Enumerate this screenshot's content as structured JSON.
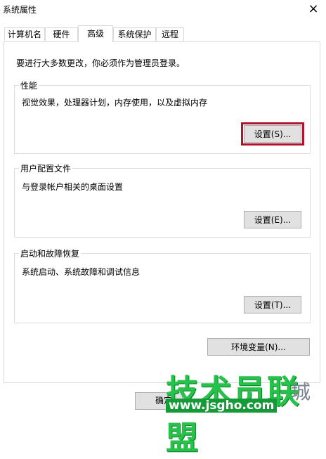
{
  "window": {
    "title": "系统属性",
    "close_glyph": "×"
  },
  "tabs": [
    {
      "label": "计算机名"
    },
    {
      "label": "硬件"
    },
    {
      "label": "高级",
      "active": true
    },
    {
      "label": "系统保护"
    },
    {
      "label": "远程"
    }
  ],
  "notice": "要进行大多数更改，你必须作为管理员登录。",
  "groups": {
    "performance": {
      "title": "性能",
      "desc": "视觉效果，处理器计划，内存使用，以及虚拟内存",
      "button": "设置(S)..."
    },
    "profile": {
      "title": "用户配置文件",
      "desc": "与登录帐户相关的桌面设置",
      "button": "设置(E)..."
    },
    "startup": {
      "title": "启动和故障恢复",
      "desc": "系统启动、系统故障和调试信息",
      "button": "设置(T)..."
    }
  },
  "env_button": "环境变量(N)...",
  "ok_button_partial": "确定",
  "watermark": {
    "main": "技术员联盟",
    "url": "www.jsgho.com",
    "side": "城"
  },
  "colors": {
    "highlight": "#b0132b",
    "watermark_green": "#27c24a"
  }
}
